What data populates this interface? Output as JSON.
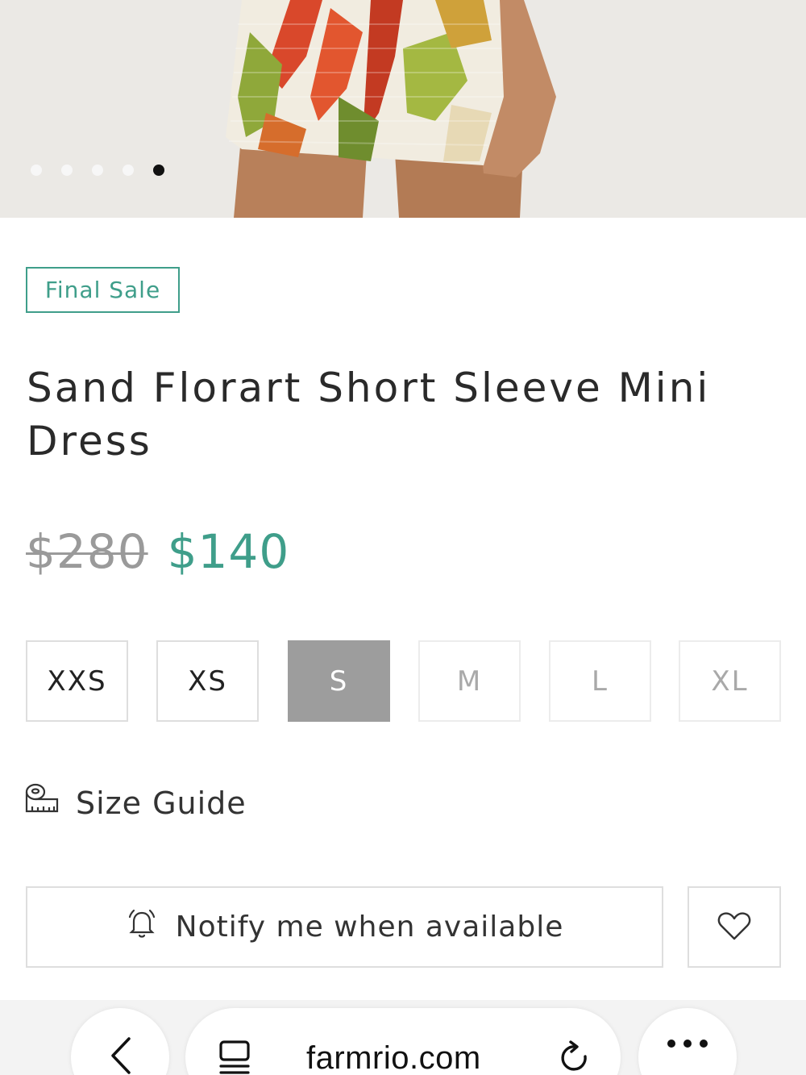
{
  "product": {
    "badge": "Final Sale",
    "title": "Sand Florart Short Sleeve Mini Dress",
    "price_original": "$280",
    "price_sale": "$140"
  },
  "gallery": {
    "slide_count": 5,
    "active_slide": 5
  },
  "sizes": [
    {
      "label": "XXS",
      "state": "available"
    },
    {
      "label": "XS",
      "state": "available"
    },
    {
      "label": "S",
      "state": "selected"
    },
    {
      "label": "M",
      "state": "unavailable"
    },
    {
      "label": "L",
      "state": "unavailable"
    },
    {
      "label": "XL",
      "state": "unavailable"
    }
  ],
  "size_guide_label": "Size Guide",
  "notify_label": "Notify me when available",
  "browser": {
    "domain": "farmrio.com"
  },
  "colors": {
    "accent": "#3f9e8a",
    "selected_size_bg": "#9d9d9d",
    "border": "#dedede"
  },
  "icons": {
    "size_guide": "measuring-tape-icon",
    "notify": "bell-icon",
    "wishlist": "heart-icon",
    "back": "chevron-left-icon",
    "tabs": "tabs-icon",
    "reload": "reload-icon",
    "more": "more-dots-icon"
  }
}
